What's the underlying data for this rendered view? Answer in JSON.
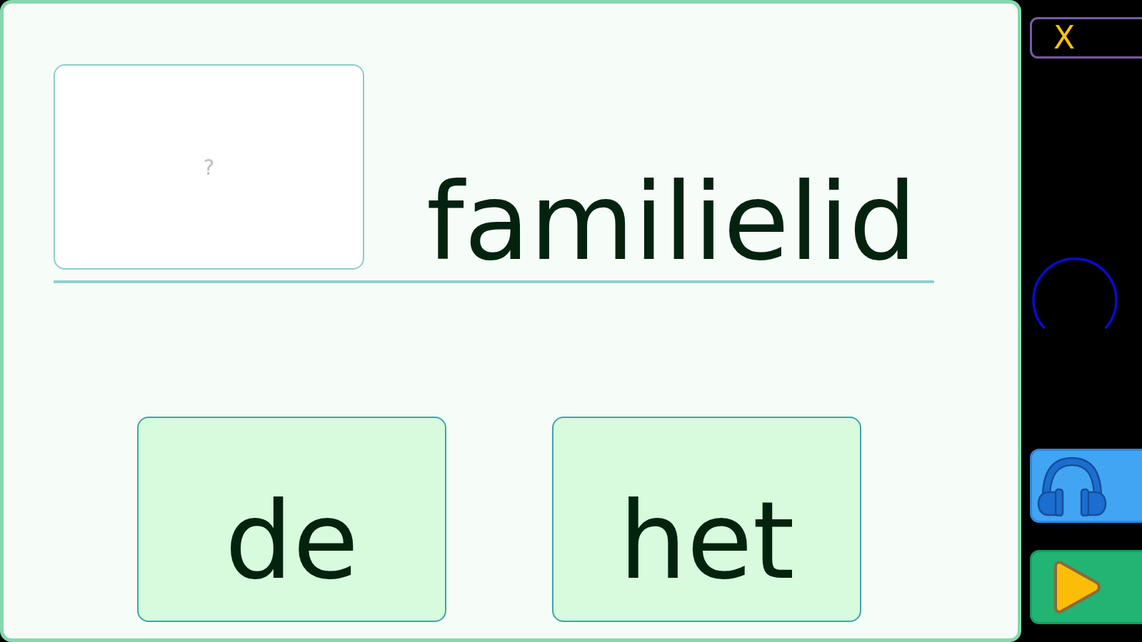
{
  "answer_box": {
    "placeholder": "?"
  },
  "word": "familielid",
  "choices": [
    {
      "label": "de"
    },
    {
      "label": "het"
    }
  ],
  "sidebar": {
    "close_button": {
      "label": "X"
    },
    "loading": true,
    "buttons": [
      {
        "kind": "listen"
      },
      {
        "kind": "play"
      }
    ]
  }
}
